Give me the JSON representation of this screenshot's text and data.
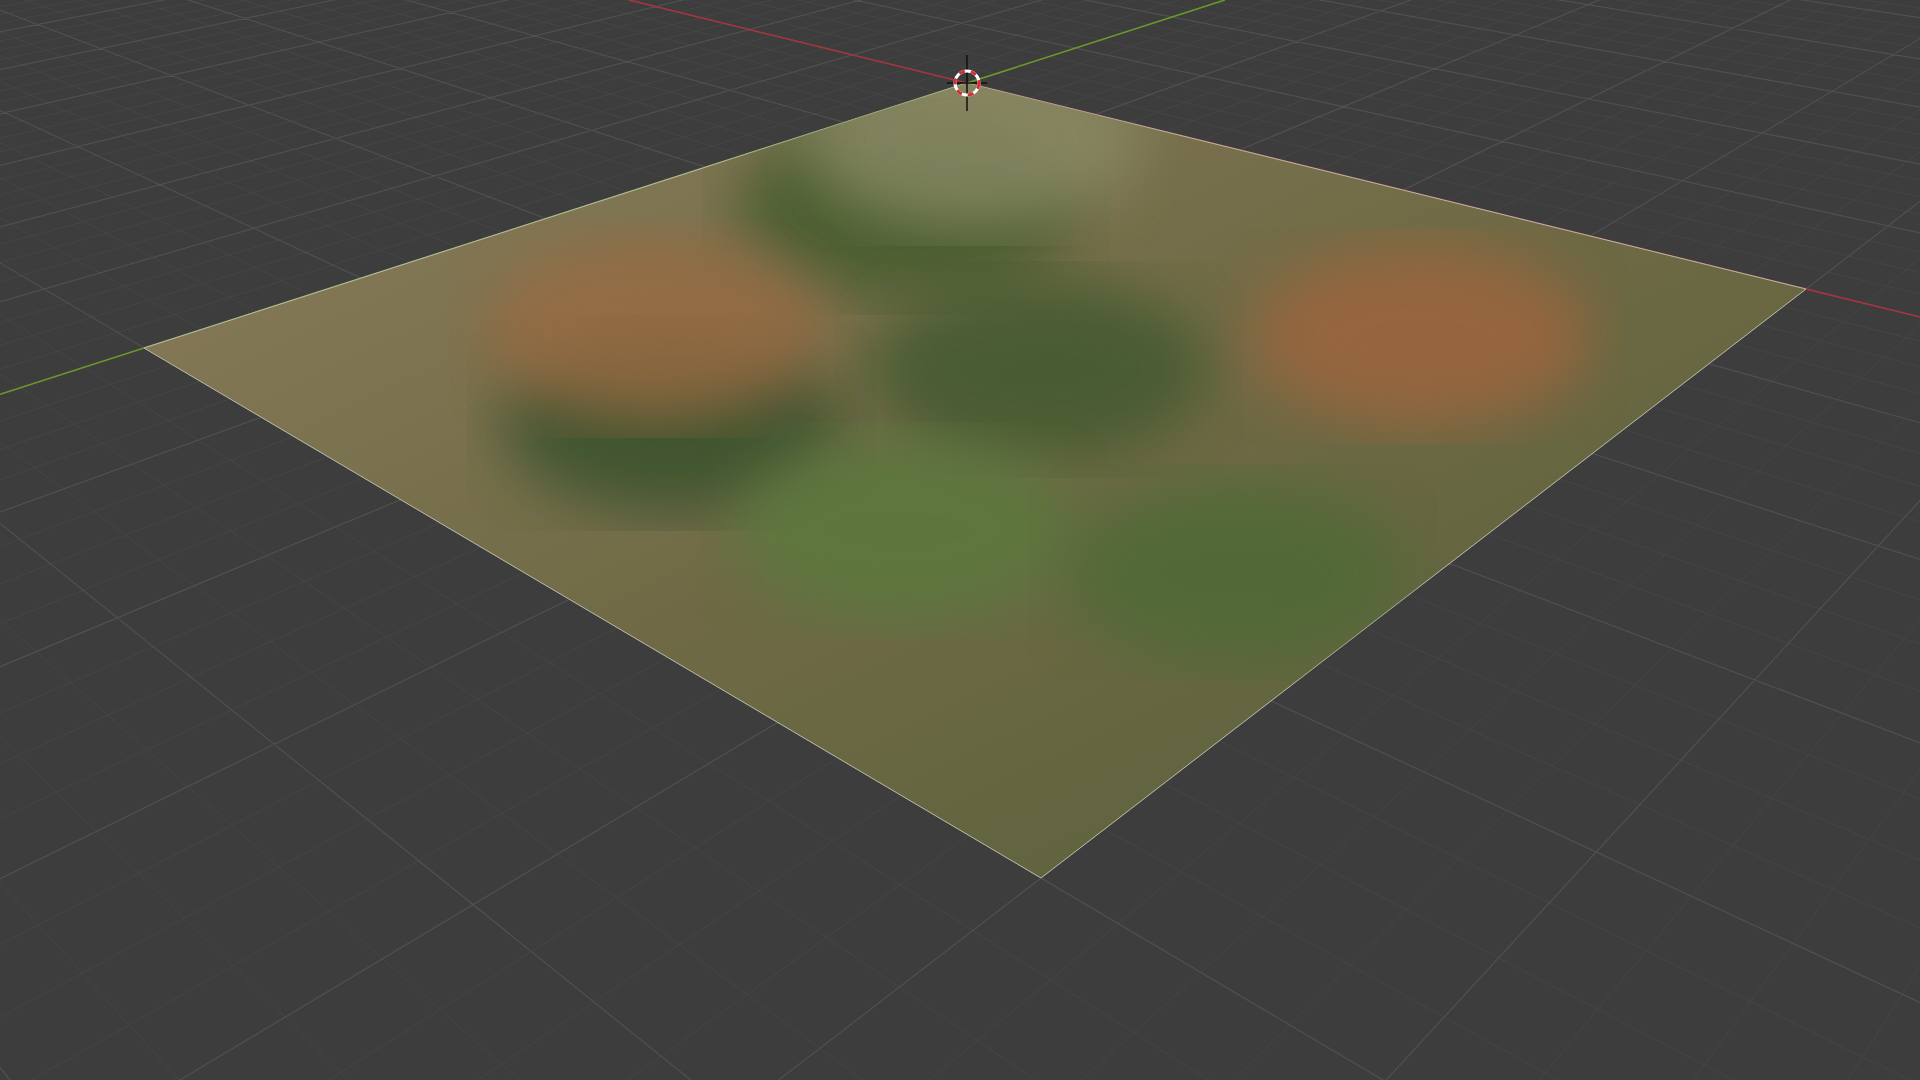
{
  "viewport": {
    "show_grid": true,
    "show_axes": true,
    "show_cursor": true,
    "show_terrain": true
  }
}
